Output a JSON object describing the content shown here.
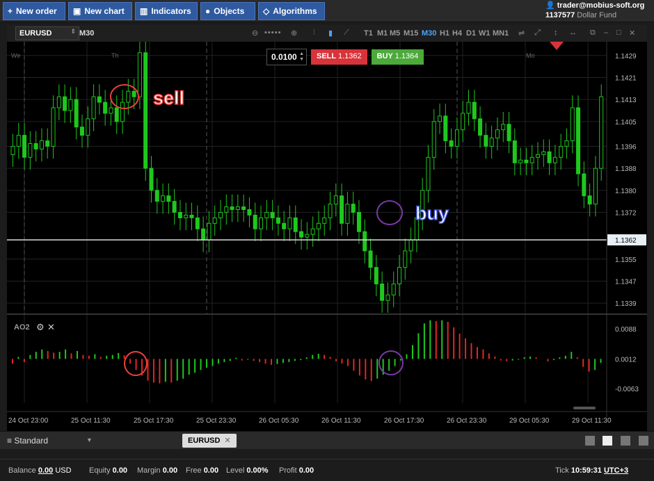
{
  "toolbar": {
    "new_order": "New order",
    "new_chart": "New chart",
    "indicators": "Indicators",
    "objects": "Objects",
    "algorithms": "Algorithms"
  },
  "account": {
    "email": "trader@mobius-soft.org",
    "number": "1137577",
    "fund": "Dollar Fund"
  },
  "chart_toolbar": {
    "symbol": "EURUSD",
    "timeframe": "M30",
    "timeframes": [
      "T1",
      "M1",
      "M5",
      "M15",
      "M30",
      "H1",
      "H4",
      "D1",
      "W1",
      "MN1"
    ],
    "active_timeframe": "M30"
  },
  "trade": {
    "quantity": "0.0100",
    "sell_label": "SELL",
    "sell_price": "1.1362",
    "buy_label": "BUY",
    "buy_price": "1.1364"
  },
  "chart": {
    "day_labels": [
      "We",
      "Th",
      "Mo"
    ],
    "price_ticks": [
      "1.1429",
      "1.1421",
      "1.1413",
      "1.1405",
      "1.1396",
      "1.1388",
      "1.1380",
      "1.1372",
      "1.1362",
      "1.1355",
      "1.1347",
      "1.1339"
    ],
    "current_price": "1.1362",
    "annotation_sell": "sell",
    "annotation_buy": "buy",
    "indicator_name": "AO2",
    "indicator_ticks": [
      "0.0088",
      "0.0012",
      "-0.0063"
    ],
    "time_ticks": [
      "24 Oct 23:00",
      "25 Oct 11:30",
      "25 Oct 17:30",
      "25 Oct 23:30",
      "26 Oct 05:30",
      "26 Oct 11:30",
      "26 Oct 17:30",
      "26 Oct 23:30",
      "29 Oct 05:30",
      "29 Oct 11:30"
    ]
  },
  "chart_data": {
    "type": "candlestick",
    "symbol": "EURUSD",
    "ylim": [
      1.1335,
      1.1434
    ],
    "closes": [
      1.1396,
      1.14,
      1.1392,
      1.1397,
      1.1395,
      1.1398,
      1.1396,
      1.141,
      1.1414,
      1.1409,
      1.1413,
      1.1403,
      1.14,
      1.1406,
      1.1414,
      1.1412,
      1.1408,
      1.141,
      1.1405,
      1.1412,
      1.1416,
      1.1414,
      1.143,
      1.1388,
      1.138,
      1.1376,
      1.1378,
      1.1376,
      1.1372,
      1.137,
      1.1371,
      1.137,
      1.1366,
      1.1362,
      1.1368,
      1.137,
      1.1372,
      1.1374,
      1.1373,
      1.1374,
      1.1373,
      1.1371,
      1.1366,
      1.137,
      1.1372,
      1.137,
      1.1368,
      1.1366,
      1.137,
      1.1365,
      1.1363,
      1.1364,
      1.1366,
      1.1368,
      1.137,
      1.1375,
      1.1378,
      1.1368,
      1.1375,
      1.1372,
      1.1365,
      1.1358,
      1.1352,
      1.1346,
      1.134,
      1.1342,
      1.1346,
      1.1352,
      1.1358,
      1.1362,
      1.137,
      1.138,
      1.1392,
      1.1405,
      1.1407,
      1.1398,
      1.1396,
      1.1402,
      1.1408,
      1.1412,
      1.1406,
      1.14,
      1.1396,
      1.1399,
      1.1402,
      1.1404,
      1.1398,
      1.139,
      1.1391,
      1.139,
      1.1392,
      1.1393,
      1.1394,
      1.139,
      1.1392,
      1.1396,
      1.1398,
      1.141,
      1.1386,
      1.1378,
      1.1375,
      1.1388,
      1.1414
    ],
    "ao_values": [
      -0.0012,
      0.0005,
      -0.0008,
      0.001,
      0.0018,
      0.0024,
      0.002,
      0.0016,
      0.0018,
      0.0024,
      0.0014,
      0.002,
      0.001,
      0.0008,
      0.0012,
      0.0005,
      0.0008,
      0.001,
      0.0015,
      0.0009,
      -0.0012,
      -0.0028,
      -0.0042,
      -0.0055,
      -0.006,
      -0.0062,
      -0.0058,
      -0.006,
      -0.0055,
      -0.005,
      -0.004,
      -0.0035,
      -0.0028,
      -0.0022,
      -0.0018,
      -0.0012,
      -0.0008,
      -0.0005,
      0.0003,
      -0.0004,
      -0.0002,
      -0.0005,
      -0.0008,
      -0.0012,
      -0.0015,
      -0.0013,
      -0.001,
      -0.0008,
      -0.0005,
      -0.0003,
      0.0004,
      0.001,
      0.0013,
      0.001,
      0.0005,
      -0.0006,
      -0.0012,
      -0.0018,
      -0.003,
      -0.0042,
      -0.0052,
      -0.0056,
      -0.005,
      -0.004,
      -0.003,
      -0.0018,
      -0.0004,
      0.0012,
      0.0035,
      0.0065,
      0.009,
      0.0098,
      0.0096,
      0.0098,
      0.0094,
      0.008,
      0.0064,
      0.0052,
      0.004,
      0.003,
      0.0024,
      0.0014,
      0.0006,
      -0.0004,
      -0.0006,
      -0.0004,
      -0.0002,
      0.0004,
      0.0006,
      0.0004,
      0.0,
      -0.0006,
      -0.0003,
      0.0004,
      0.0008,
      0.0018,
      0.0004,
      -0.002,
      -0.0032,
      -0.0028,
      -0.001
    ]
  },
  "bottom": {
    "layout": "Standard",
    "tab": "EURUSD"
  },
  "status": {
    "balance_label": "Balance",
    "balance": "0.00",
    "currency": "USD",
    "equity_label": "Equity",
    "equity": "0.00",
    "margin_label": "Margin",
    "margin": "0.00",
    "free_label": "Free",
    "free": "0.00",
    "level_label": "Level",
    "level": "0.00%",
    "profit_label": "Profit",
    "profit": "0.00",
    "tick_label": "Tick",
    "time": "10:59:31",
    "timezone": "UTC+3"
  }
}
